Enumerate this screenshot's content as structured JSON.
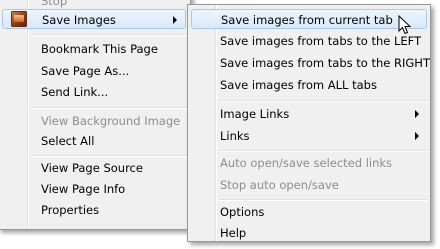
{
  "main_menu": {
    "items": [
      {
        "label": "Stop",
        "disabled": true
      },
      {
        "label": "Save Images",
        "icon": "save-images-icon",
        "highlighted": true,
        "submenu": true
      },
      {
        "label": "Bookmark This Page"
      },
      {
        "label": "Save Page As..."
      },
      {
        "label": "Send Link..."
      },
      {
        "label": "View Background Image",
        "disabled": true
      },
      {
        "label": "Select All"
      },
      {
        "label": "View Page Source"
      },
      {
        "label": "View Page Info"
      },
      {
        "label": "Properties"
      }
    ]
  },
  "submenu": {
    "items": [
      {
        "label": "Save images from current tab",
        "highlighted": true
      },
      {
        "label": "Save images from tabs to the LEFT"
      },
      {
        "label": "Save images from tabs to the RIGHT"
      },
      {
        "label": "Save images from ALL tabs"
      },
      {
        "label": "Image Links",
        "submenu": true
      },
      {
        "label": "Links",
        "submenu": true
      },
      {
        "label": "Auto open/save selected links",
        "disabled": true
      },
      {
        "label": "Stop auto open/save",
        "disabled": true
      },
      {
        "label": "Options"
      },
      {
        "label": "Help"
      }
    ]
  },
  "colors": {
    "menu_background": "#f0f0f0",
    "highlight_border": "#a8c8ec",
    "disabled_text": "#8d8d8d"
  }
}
